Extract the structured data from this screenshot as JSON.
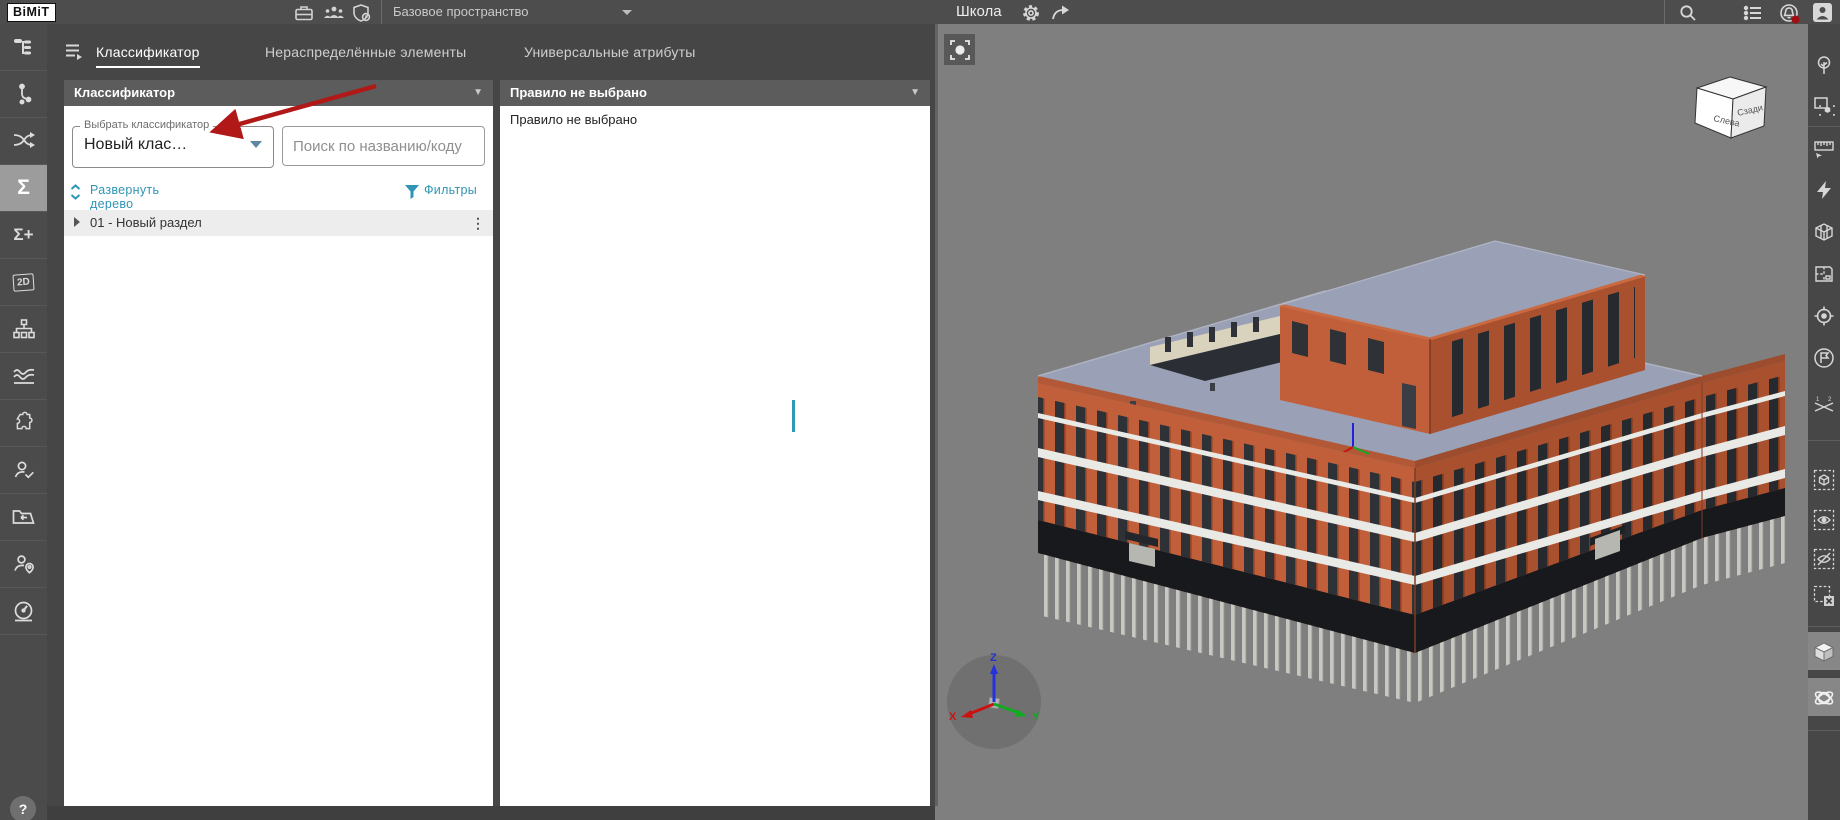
{
  "topbar": {
    "logo": "BiMiT",
    "workspace_label": "Базовое пространство",
    "project_title": "Школа"
  },
  "sidebar": {
    "sigma": "Σ",
    "sigma_plus": "Σ+",
    "two_d": "2D",
    "help": "?",
    "items": [
      "model-tree",
      "connections",
      "distribute",
      "classifier-sigma",
      "classifier-add",
      "2d-view",
      "structure",
      "graphs",
      "plugins",
      "user-check",
      "import-folder",
      "user-location",
      "dashboard"
    ]
  },
  "panel": {
    "tabs": [
      {
        "label": "Классификатор",
        "active": true
      },
      {
        "label": "Нераспределённые элементы",
        "active": false
      },
      {
        "label": "Универсальные атрибуты",
        "active": false
      }
    ],
    "classifier": {
      "header": "Классификатор",
      "select_label": "Выбрать классификатор",
      "select_value": "Новый клас…",
      "search_placeholder": "Поиск по названию/коду",
      "expand_tree": "Развернуть дерево",
      "filters": "Фильтры",
      "tree": [
        {
          "label": "01 - Новый раздел"
        }
      ]
    },
    "rule": {
      "header": "Правило не выбрано",
      "empty_text": "Правило не выбрано"
    }
  },
  "viewport": {
    "view_cube": {
      "left_face": "Слева",
      "right_face": "Сзади"
    },
    "axes": {
      "x": "X",
      "y": "Y",
      "z": "Z"
    },
    "building_colors": {
      "wall": "#c05f39",
      "wall_dark": "#a9502f",
      "roof": "#9aa0b5",
      "window": "#2e3237",
      "band": "#e9e9e6",
      "base": "#17191d",
      "pile": "#c8c8c2",
      "court_wall": "#d9d2bd"
    }
  },
  "accent": {
    "teal": "#2f95b5",
    "arrow_red": "#b11818"
  }
}
